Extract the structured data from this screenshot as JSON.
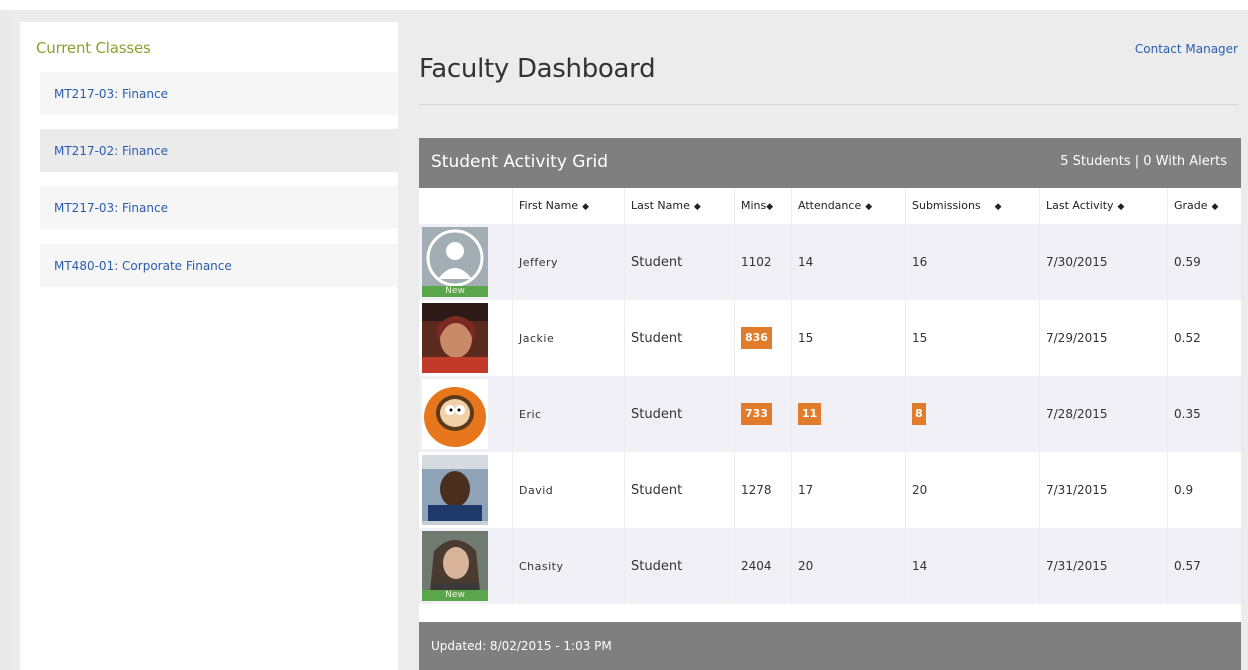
{
  "sidebar": {
    "title": "Current Classes",
    "classes": [
      {
        "label": "MT217-03: Finance"
      },
      {
        "label": "MT217-02: Finance"
      },
      {
        "label": "MT217-03: Finance"
      },
      {
        "label": "MT480-01: Corporate Finance"
      }
    ]
  },
  "header": {
    "title": "Faculty Dashboard",
    "contact_link": "Contact Manager"
  },
  "grid": {
    "title": "Student Activity Grid",
    "summary": "5 Students | 0 With Alerts",
    "sort_icon": "◆",
    "columns": [
      {
        "label": "First Name"
      },
      {
        "label": "Last Name"
      },
      {
        "label": "Mins"
      },
      {
        "label": "Attendance"
      },
      {
        "label": "Submissions"
      },
      {
        "label": "Last Activity"
      },
      {
        "label": "Grade"
      }
    ],
    "rows": [
      {
        "first": "Jeffery",
        "last": "Student",
        "mins": "1102",
        "attendance": "14",
        "submissions": "16",
        "last_activity": "7/30/2015",
        "grade": "0.59",
        "new": "New",
        "avatar": "default-silhouette"
      },
      {
        "first": "Jackie",
        "last": "Student",
        "mins": "836",
        "attendance": "15",
        "submissions": "15",
        "last_activity": "7/29/2015",
        "grade": "0.52",
        "avatar": "photo"
      },
      {
        "first": "Eric",
        "last": "Student",
        "mins": "733",
        "attendance": "11",
        "submissions": "8",
        "last_activity": "7/28/2015",
        "grade": "0.35",
        "avatar": "cartoon"
      },
      {
        "first": "David",
        "last": "Student",
        "mins": "1278",
        "attendance": "17",
        "submissions": "20",
        "last_activity": "7/31/2015",
        "grade": "0.9",
        "avatar": "photo"
      },
      {
        "first": "Chasity",
        "last": "Student",
        "mins": "2404",
        "attendance": "20",
        "submissions": "14",
        "last_activity": "7/31/2015",
        "grade": "0.57",
        "new": "New",
        "avatar": "photo"
      }
    ],
    "footer": "Updated: 8/02/2015 - 1:03 PM"
  },
  "colors": {
    "alert": "#e07c2c",
    "link": "#2a5db0",
    "sidebar_title": "#8ba22e",
    "grid_bar": "#7f7f7f"
  }
}
